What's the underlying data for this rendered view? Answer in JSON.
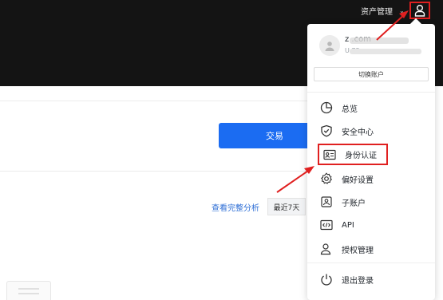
{
  "header": {
    "asset_menu_label": "资产管理",
    "chevron": "⌄"
  },
  "main": {
    "trade_button": "交易",
    "analysis_link": "查看完整分析",
    "range_select": "最近7天"
  },
  "account_menu": {
    "email": "z                  .com",
    "uid": "U                          73",
    "switch_account": "切换账户",
    "items": [
      {
        "label": "总览",
        "icon": "pie-chart-icon"
      },
      {
        "label": "安全中心",
        "icon": "shield-check-icon"
      },
      {
        "label": "身份认证",
        "icon": "id-card-icon"
      },
      {
        "label": "偏好设置",
        "icon": "gear-icon"
      },
      {
        "label": "子账户",
        "icon": "sub-account-icon"
      },
      {
        "label": "API",
        "icon": "api-icon"
      },
      {
        "label": "授权管理",
        "icon": "user-key-icon"
      },
      {
        "label": "退出登录",
        "icon": "power-icon"
      }
    ]
  },
  "colors": {
    "accent_blue": "#1b6cf2",
    "highlight_red": "#e02020",
    "topbar": "#141414"
  }
}
